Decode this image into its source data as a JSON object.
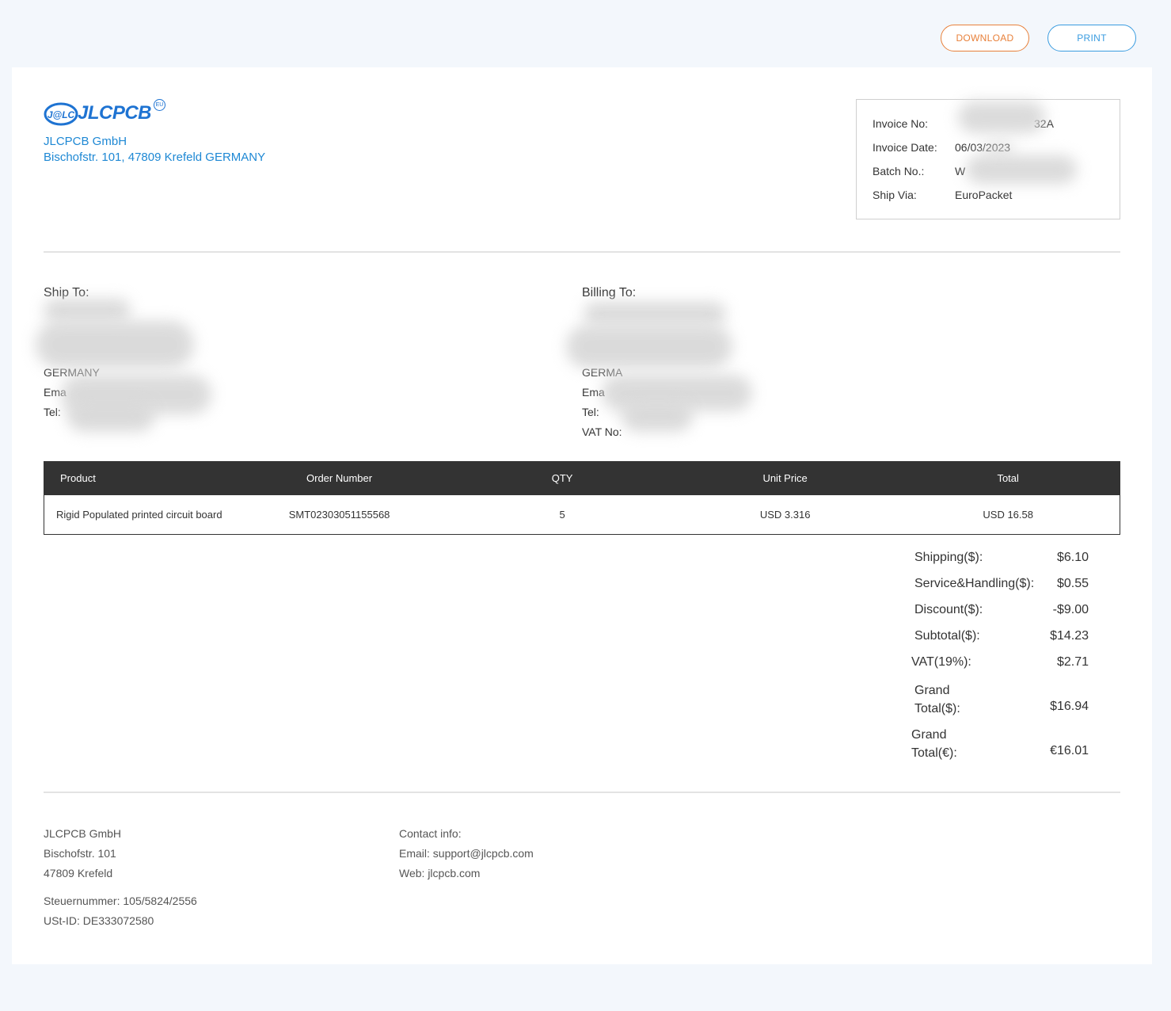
{
  "toolbar": {
    "download_label": "DOWNLOAD",
    "print_label": "PRINT"
  },
  "header": {
    "logo_mark": "J@LC",
    "logo_text": "JLCPCB",
    "logo_badge": "EU",
    "company_name": "JLCPCB GmbH",
    "company_address": "Bischofstr. 101, 47809 Krefeld GERMANY"
  },
  "meta": {
    "invoice_no_label": "Invoice No:",
    "invoice_no_value": "32A",
    "invoice_date_label": "Invoice Date:",
    "invoice_date_value": "06/03/2023",
    "batch_no_label": "Batch No.:",
    "batch_no_value": "W",
    "ship_via_label": "Ship Via:",
    "ship_via_value": "EuroPacket"
  },
  "ship_to": {
    "title": "Ship To:",
    "country": "GERMANY",
    "email_label": "Ema",
    "tel_label": "Tel:"
  },
  "billing_to": {
    "title": "Billing To:",
    "country": "GERMA",
    "email_label": "Ema",
    "tel_label": "Tel: ",
    "vat_label": "VAT No:"
  },
  "items": {
    "headers": [
      "Product",
      "Order Number",
      "QTY",
      "Unit Price",
      "Total"
    ],
    "rows": [
      {
        "product": "Rigid Populated printed circuit board",
        "order_number": "SMT02303051155568",
        "qty": "5",
        "unit_price": "USD 3.316",
        "total": "USD 16.58"
      }
    ]
  },
  "totals": {
    "shipping_label": "Shipping($):",
    "shipping_value": "$6.10",
    "service_label": "Service&Handling($):",
    "service_value": "$0.55",
    "discount_label": "Discount($):",
    "discount_value": "-$9.00",
    "subtotal_label": "Subtotal($):",
    "subtotal_value": "$14.23",
    "vat_label": "VAT(19%):",
    "vat_value": "$2.71",
    "grand_usd_label_1": "Grand",
    "grand_usd_label_2": "Total($):",
    "grand_usd_value": "$16.94",
    "grand_eur_label_1": "Grand",
    "grand_eur_label_2": "Total(€):",
    "grand_eur_value": "€16.01"
  },
  "footer": {
    "company_name": "JLCPCB GmbH",
    "street": "Bischofstr. 101",
    "city": "47809 Krefeld",
    "tax_number": "Steuernummer: 105/5824/2556",
    "ust_id": "USt-ID: DE333072580",
    "contact_title": "Contact info:",
    "email": "Email: support@jlcpcb.com",
    "web": "Web: jlcpcb.com"
  }
}
